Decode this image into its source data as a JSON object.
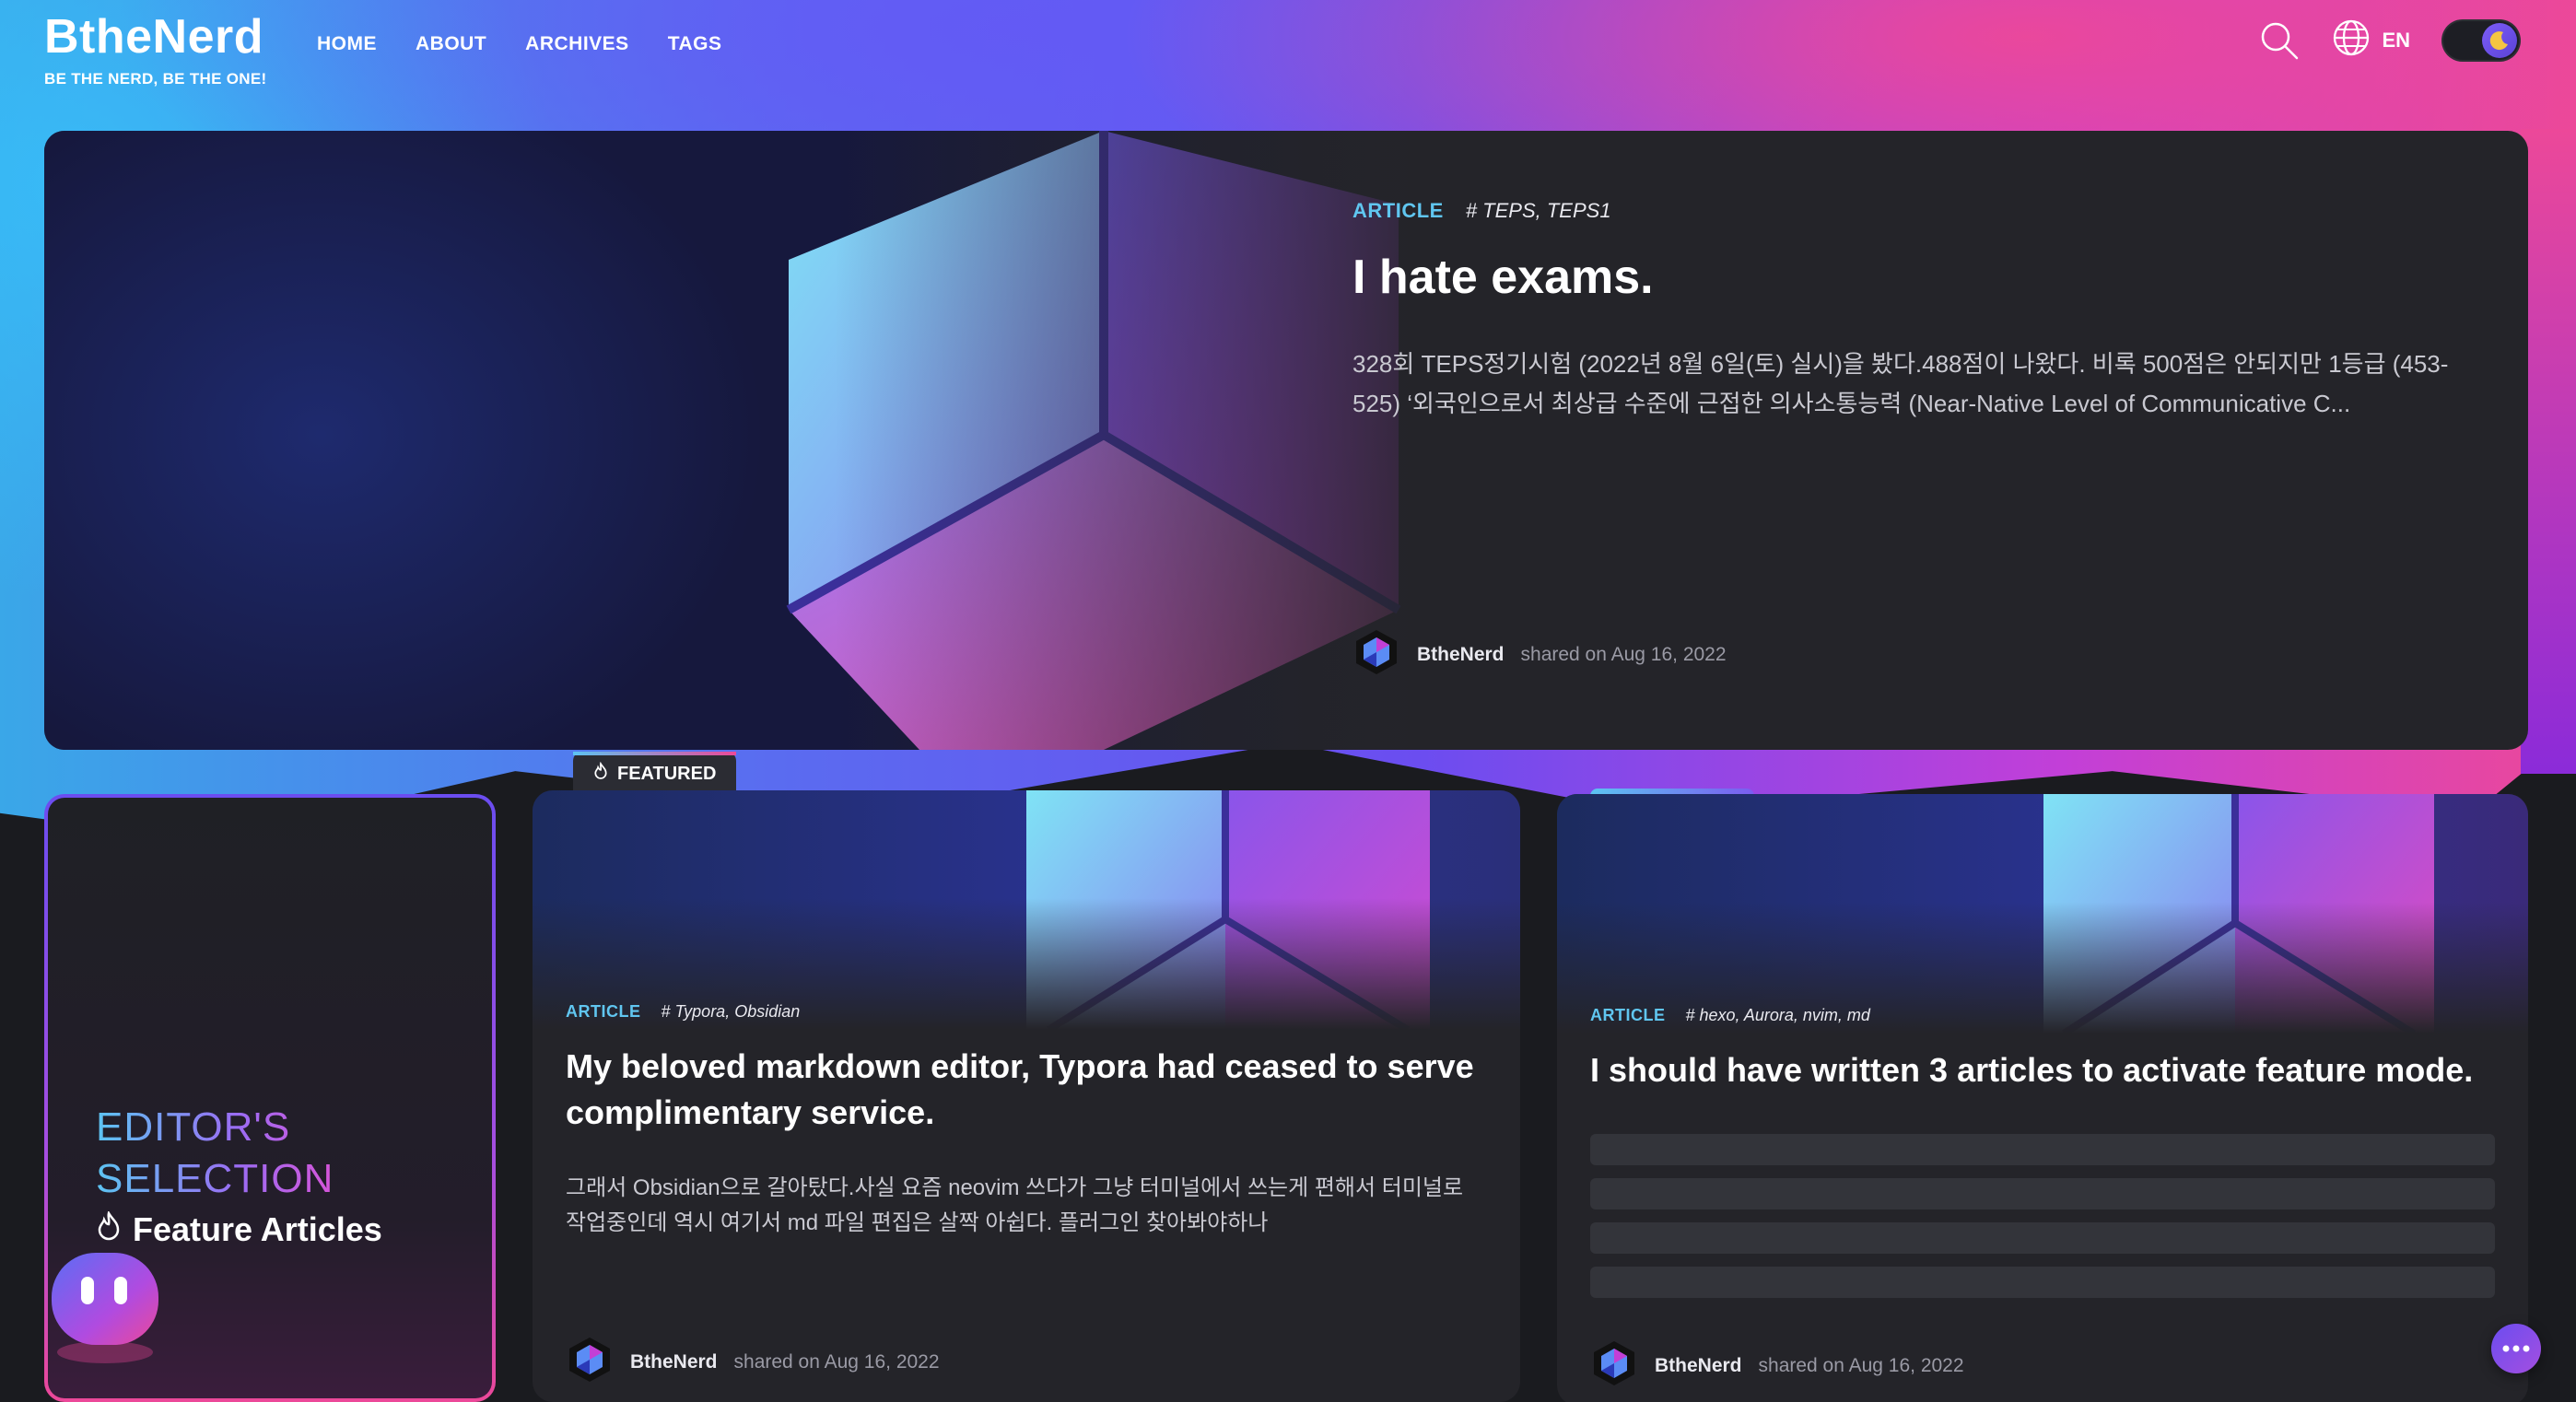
{
  "brand": {
    "title": "BtheNerd",
    "subtitle": "BE THE NERD, BE THE ONE!"
  },
  "nav": {
    "items": [
      {
        "label": "HOME"
      },
      {
        "label": "ABOUT"
      },
      {
        "label": "ARCHIVES"
      },
      {
        "label": "TAGS"
      }
    ]
  },
  "toolbar": {
    "search_icon": "search-icon",
    "language_icon": "globe-icon",
    "language": "EN",
    "theme_icon": "moon-icon"
  },
  "hero": {
    "type": "ARTICLE",
    "tags": "# TEPS, TEPS1",
    "title": "I hate exams.",
    "excerpt": "328회 TEPS정기시험 (2022년 8월 6일(토) 실시)을 봤다.488점이 나왔다. 비록 500점은 안되지만 1등급 (453-525) ‘외국인으로서 최상급 수준에 근접한 의사소통능력 (Near-Native Level of Communicative C...",
    "author": "BtheNerd",
    "shared": "shared on Aug 16, 2022"
  },
  "editor": {
    "title_line1": "EDITOR'S",
    "title_line2": "SELECTION",
    "subtitle": "Feature Articles"
  },
  "featured_badge": "FEATURED",
  "cards": [
    {
      "type": "ARTICLE",
      "tags": "# Typora, Obsidian",
      "title": "My beloved markdown editor, Typora had ceased to serve complimentary service.",
      "excerpt": "그래서 Obsidian으로 갈아탔다.사실 요즘 neovim 쓰다가 그냥 터미널에서 쓰는게 편해서 터미널로 작업중인데 역시 여기서 md 파일 편집은 살짝 아쉽다. 플러그인 찾아봐야하나",
      "author": "BtheNerd",
      "shared": "shared on Aug 16, 2022"
    },
    {
      "type": "ARTICLE",
      "tags": "# hexo, Aurora, nvim, md",
      "title": "I should have written 3 articles to activate feature mode.",
      "author": "BtheNerd",
      "shared": "shared on Aug 16, 2022"
    }
  ],
  "colors": {
    "accent_cyan": "#60c6f0",
    "accent_purple": "#6b4df0",
    "accent_pink": "#ec4899",
    "card_bg": "#242429",
    "page_bg": "#1a1b1f"
  }
}
